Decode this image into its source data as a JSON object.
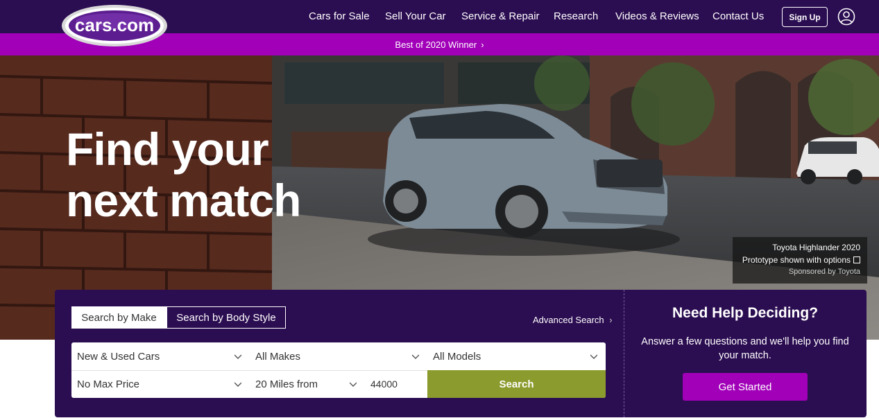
{
  "header": {
    "logo_text": "cars.com",
    "nav": [
      "Cars for Sale",
      "Sell Your Car",
      "Service & Repair",
      "Research",
      "Videos & Reviews",
      "Contact Us"
    ],
    "signup_label": "Sign Up",
    "user_icon": "user-icon"
  },
  "promo": {
    "label": "Best of 2020 Winner",
    "chevron": "›"
  },
  "hero": {
    "headline_line1": "Find your",
    "headline_line2": "next match",
    "sponsor": {
      "model": "Toyota Highlander 2020",
      "note": "Prototype shown with options",
      "sponsor_line": "Sponsored by Toyota",
      "icon": "external-link-icon"
    }
  },
  "search": {
    "tabs": [
      "Search by Make",
      "Search by Body Style"
    ],
    "advanced_label": "Advanced Search",
    "stock_type": "New & Used Cars",
    "make": "All Makes",
    "model": "All Models",
    "price": "No Max Price",
    "distance": "20 Miles from",
    "zip": "44000",
    "search_label": "Search"
  },
  "help": {
    "title": "Need Help Deciding?",
    "text": "Answer a few questions and we'll help you find your match.",
    "button_label": "Get Started"
  },
  "colors": {
    "header_bg": "#2b0d51",
    "promo_bg": "#a100b8",
    "search_button": "#8c9b2e",
    "cta_button": "#a100b8"
  }
}
